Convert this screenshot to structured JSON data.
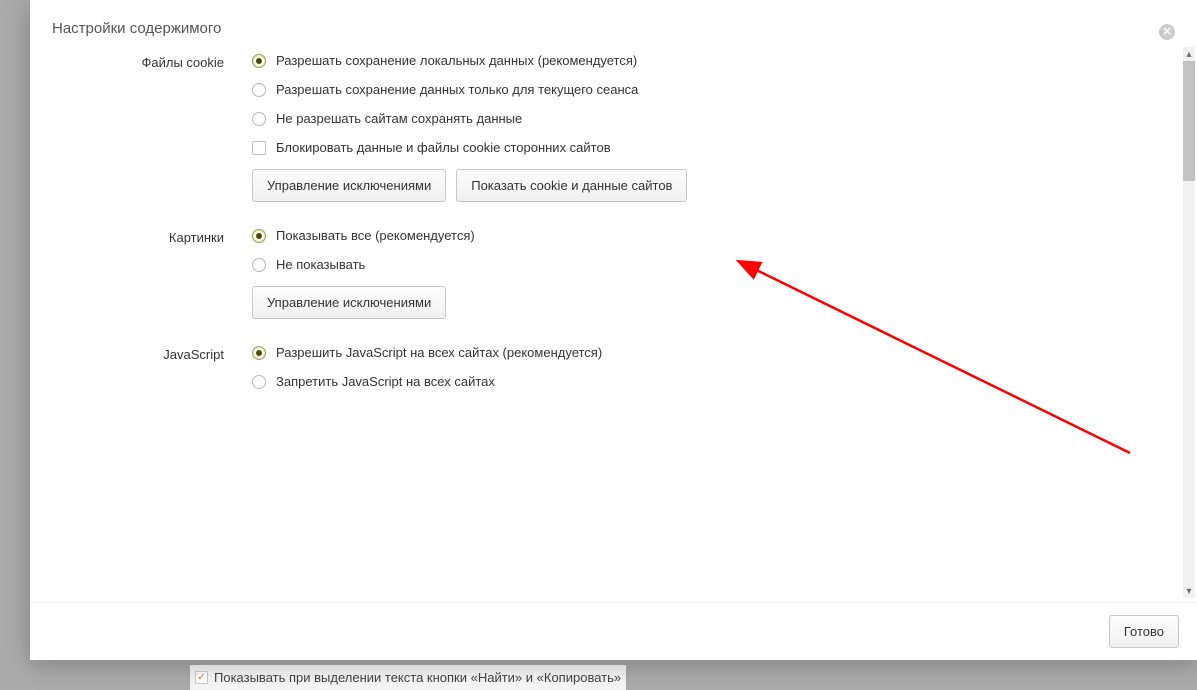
{
  "dialog": {
    "title": "Настройки содержимого",
    "done_button": "Готово"
  },
  "cookies": {
    "label": "Файлы cookie",
    "opt_allow": "Разрешать сохранение локальных данных (рекомендуется)",
    "opt_session": "Разрешать сохранение данных только для текущего сеанса",
    "opt_block": "Не разрешать сайтам сохранять данные",
    "block_third_party": "Блокировать данные и файлы cookie сторонних сайтов",
    "manage_exceptions": "Управление исключениями",
    "show_cookies": "Показать cookie и данные сайтов"
  },
  "images": {
    "label": "Картинки",
    "opt_show_all": "Показывать все (рекомендуется)",
    "opt_hide": "Не показывать",
    "manage_exceptions": "Управление исключениями"
  },
  "javascript": {
    "label": "JavaScript",
    "opt_allow": "Разрешить JavaScript на всех сайтах (рекомендуется)",
    "opt_block": "Запретить JavaScript на всех сайтах"
  },
  "backdrop": {
    "text": "Показывать при выделении текста кнопки «Найти» и «Копировать»"
  }
}
